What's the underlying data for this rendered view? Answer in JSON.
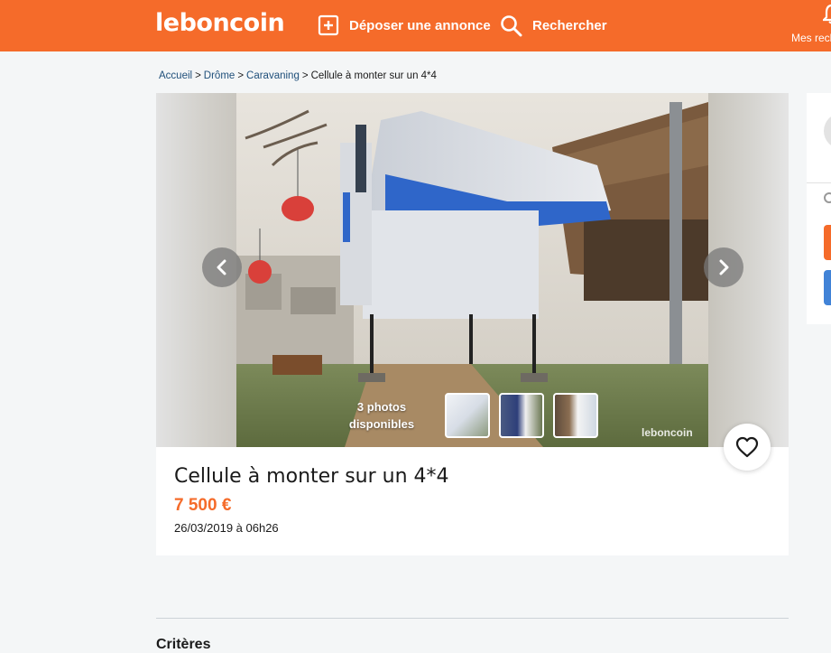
{
  "header": {
    "logo": "leboncoin",
    "post_label": "Déposer une annonce",
    "search_label": "Rechercher",
    "messages_label": "Mes rech"
  },
  "breadcrumb": [
    "Accueil",
    "Drôme",
    "Caravaning",
    "Cellule à monter sur un 4*4"
  ],
  "gallery": {
    "photo_count": "3 photos",
    "photo_count_sub": "disponibles",
    "watermark": "leboncoin"
  },
  "ad": {
    "title": "Cellule à monter sur un 4*4",
    "price": "7 500 €",
    "date": "26/03/2019 à 06h26"
  },
  "sections": {
    "criteria": "Critères"
  },
  "colors": {
    "brand": "#f56b2a",
    "link": "#1f4f7a",
    "secondary_button": "#4183d7"
  },
  "icons": [
    "plus-square-icon",
    "search-icon",
    "bell-icon",
    "chevron-left-icon",
    "chevron-right-icon",
    "heart-icon"
  ]
}
